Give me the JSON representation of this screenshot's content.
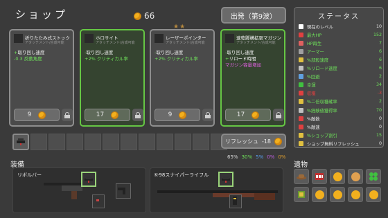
{
  "header": {
    "title": "ショップ",
    "coins": "66",
    "start_button": "出発（第9波）",
    "tier_stars": "★★"
  },
  "cards": [
    {
      "name": "折りたたみ式ストック",
      "subtitle": "アタッチメント/合成可能",
      "stats": [
        {
          "text": "取り回し速度",
          "prefix": "+",
          "kind": "pos"
        },
        {
          "text": "-0.3 反動角度",
          "prefix": "",
          "kind": "pos"
        }
      ],
      "price": "9",
      "highlight": false
    },
    {
      "name": "ホロサイト",
      "subtitle": "アタッチメント/合成可能",
      "stats": [
        {
          "text": "取り回し速度",
          "prefix": "",
          "kind": "neg"
        },
        {
          "text": "+2% クリティカル率",
          "prefix": "",
          "kind": "pos"
        }
      ],
      "price": "17",
      "highlight": true
    },
    {
      "name": "レーザーポインター",
      "subtitle": "アタッチメント/合成可能",
      "stats": [
        {
          "text": "取り回し速度",
          "prefix": "",
          "kind": "neg"
        },
        {
          "text": "+2% クリティカル率",
          "prefix": "",
          "kind": "pos"
        }
      ],
      "price": "9",
      "highlight": false
    },
    {
      "name": "速乾脚構拡張マガジン",
      "subtitle": "アタッチメント/合成可能",
      "stats": [
        {
          "text": "取り回し速度",
          "prefix": "",
          "kind": "neg"
        },
        {
          "text": "リロード時間",
          "prefix": "",
          "kind": "neg"
        },
        {
          "text": "マガジン容量増加",
          "prefix": "",
          "kind": "mag"
        }
      ],
      "price": "17",
      "highlight": true
    }
  ],
  "refresh_button": {
    "label": "リフレッシュ",
    "cost": "-18"
  },
  "rarity": [
    {
      "text": "65%",
      "color": "#d8d8d8"
    },
    {
      "text": "30%",
      "color": "#6ee05a"
    },
    {
      "text": "5%",
      "color": "#5aa0f0"
    },
    {
      "text": "0%",
      "color": "#c060e0"
    },
    {
      "text": "0%",
      "color": "#e0a030"
    }
  ],
  "equipment": {
    "label": "装備",
    "weapons": [
      {
        "name": "リボルバー"
      },
      {
        "name": "K-98スナイパーライフル"
      }
    ]
  },
  "relics_label": "遺物",
  "status": {
    "title": "ステータス",
    "rows": [
      {
        "label": "現在のレベル",
        "value": "10",
        "color": "#e6e6e6",
        "icon": "#ffffff"
      },
      {
        "label": "最大HP",
        "value": "152",
        "color": "#6ee05a",
        "icon": "#e04040"
      },
      {
        "label": "HP再生",
        "value": "7",
        "color": "#6ee05a",
        "icon": "#e06060"
      },
      {
        "label": "アーマー",
        "value": "6",
        "color": "#6ee05a",
        "icon": "#a0a0a0"
      },
      {
        "label": "%部殺速度",
        "value": "6",
        "color": "#6ee05a",
        "icon": "#e0c040"
      },
      {
        "label": "%リロード速度",
        "value": "6",
        "color": "#6ee05a",
        "icon": "#c0c0c0"
      },
      {
        "label": "%回避",
        "value": "2",
        "color": "#6ee05a",
        "icon": "#60a0e0"
      },
      {
        "label": "幸運",
        "value": "34",
        "color": "#6ee05a",
        "icon": "#40c040"
      },
      {
        "label": "収穫",
        "value": "-3",
        "color": "#e04040",
        "icon": "#e04040"
      },
      {
        "label": "%二倍収穫確率",
        "value": "2",
        "color": "#6ee05a",
        "icon": "#e0c040"
      },
      {
        "label": "%経験値獲得率",
        "value": "70",
        "color": "#6ee05a",
        "icon": "#c0c0c0"
      },
      {
        "label": "%敵数",
        "value": "0",
        "color": "#e6e6e6",
        "icon": "#e04040"
      },
      {
        "label": "%敵速",
        "value": "0",
        "color": "#e6e6e6",
        "icon": "#e04040"
      },
      {
        "label": "%ショップ割引",
        "value": "15",
        "color": "#6ee05a",
        "icon": "#e0c040"
      },
      {
        "label": "ショップ無料リフレッシュ",
        "value": "0",
        "color": "#e6e6e6",
        "icon": "#e0c040"
      }
    ]
  }
}
